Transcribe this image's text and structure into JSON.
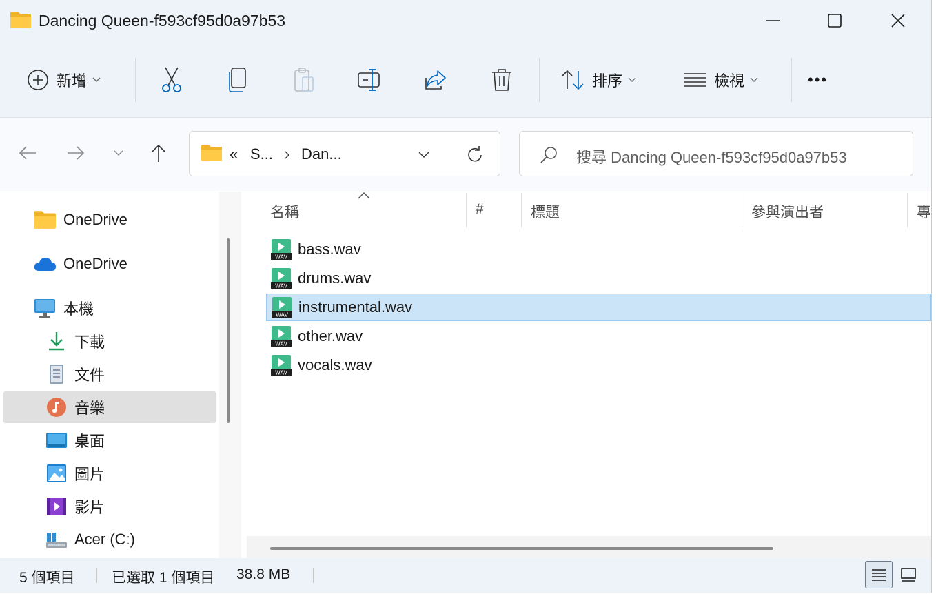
{
  "window": {
    "title": "Dancing Queen-f593cf95d0a97b53",
    "minimize_icon": "minimize-icon",
    "maximize_icon": "maximize-icon",
    "close_icon": "close-icon"
  },
  "toolbar": {
    "new_label": "新增",
    "cut_icon": "scissors-icon",
    "copy_icon": "copy-icon",
    "paste_icon": "paste-icon",
    "rename_icon": "rename-icon",
    "share_icon": "share-icon",
    "delete_icon": "trash-icon",
    "sort_label": "排序",
    "view_label": "檢視",
    "more_label": "•••"
  },
  "nav": {
    "address_prefix": "«",
    "address_segments": [
      "S...",
      "Dan..."
    ],
    "search_placeholder": "搜尋 Dancing Queen-f593cf95d0a97b53"
  },
  "sidebar": {
    "items": [
      {
        "label": "OneDrive",
        "icon": "folder-icon"
      },
      {
        "label": "OneDrive",
        "icon": "cloud-icon"
      },
      {
        "label": "本機",
        "icon": "monitor-icon"
      },
      {
        "label": "下載",
        "icon": "download-icon"
      },
      {
        "label": "文件",
        "icon": "document-icon"
      },
      {
        "label": "音樂",
        "icon": "music-icon",
        "selected": true
      },
      {
        "label": "桌面",
        "icon": "desktop-icon"
      },
      {
        "label": "圖片",
        "icon": "pictures-icon"
      },
      {
        "label": "影片",
        "icon": "videos-icon"
      },
      {
        "label": "Acer (C:)",
        "icon": "drive-icon"
      }
    ]
  },
  "columns": [
    "名稱",
    "#",
    "標題",
    "參與演出者",
    "專"
  ],
  "files": [
    {
      "name": "bass.wav",
      "selected": false
    },
    {
      "name": "drums.wav",
      "selected": false
    },
    {
      "name": "instrumental.wav",
      "selected": true
    },
    {
      "name": "other.wav",
      "selected": false
    },
    {
      "name": "vocals.wav",
      "selected": false
    }
  ],
  "status": {
    "item_count": "5 個項目",
    "selection": "已選取 1 個項目",
    "size": "38.8 MB"
  },
  "colors": {
    "accent": "#0067c0",
    "selection_bg": "#cce4f7",
    "chrome_bg": "#eef3f9"
  }
}
